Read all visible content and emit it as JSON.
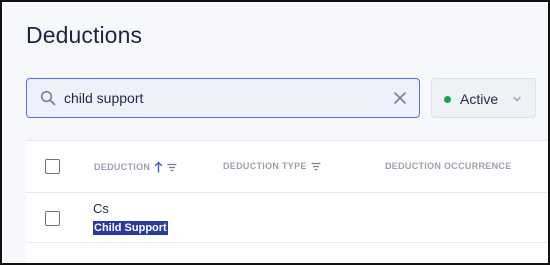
{
  "page": {
    "title": "Deductions"
  },
  "search": {
    "value": "child support",
    "search_icon": "search-icon",
    "clear_icon": "close-icon"
  },
  "status_filter": {
    "selected": "Active",
    "indicator_color": "#16a34a",
    "icon": "chevron-down-icon"
  },
  "table": {
    "columns": [
      {
        "label": "DEDUCTION",
        "sort": "ascending",
        "filter": true
      },
      {
        "label": "DEDUCTION TYPE",
        "filter": true
      },
      {
        "label": "DEDUCTION OCCURRENCE"
      }
    ],
    "rows": [
      {
        "code": "Cs",
        "description": "Child Support",
        "description_highlighted": true
      }
    ]
  },
  "colors": {
    "accent": "#5a6fd8",
    "sort_icon": "#3b5bdb",
    "highlight": "#2b3aa0"
  }
}
